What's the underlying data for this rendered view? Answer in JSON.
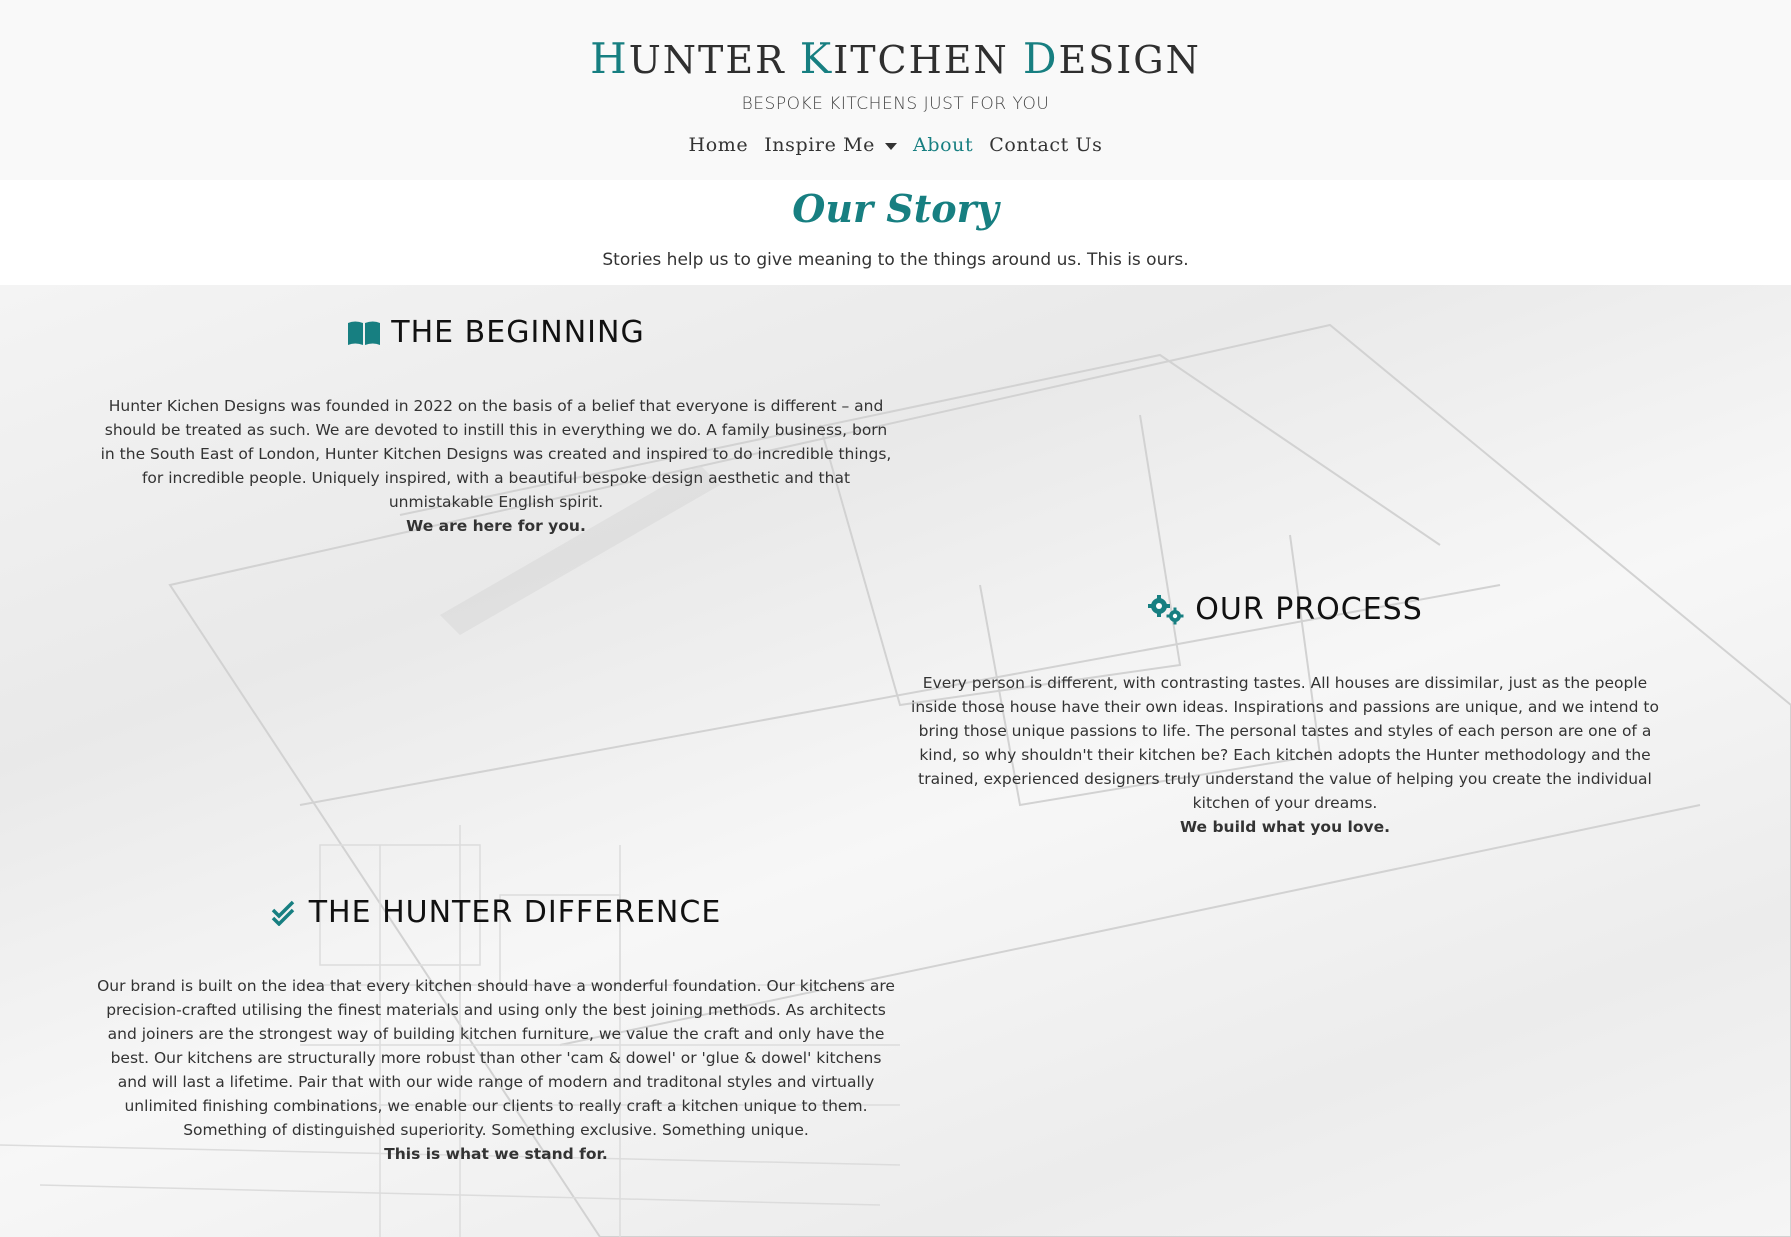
{
  "header": {
    "brand": {
      "w1_cap": "H",
      "w1_rest": "UNTER ",
      "w2_cap": "K",
      "w2_rest": "ITCHEN ",
      "w3_cap": "D",
      "w3_rest": "ESIGN"
    },
    "tagline": "BESPOKE KITCHENS JUST FOR YOU",
    "nav": {
      "home": "Home",
      "inspire": "Inspire Me",
      "about": "About",
      "contact": "Contact Us"
    },
    "accent_color": "#177f81"
  },
  "story": {
    "title": "Our Story",
    "subtitle": "Stories help us to give meaning to the things around us. This is ours."
  },
  "sections": {
    "beginning": {
      "icon": "book-open-icon",
      "title": "THE BEGINNING",
      "body": "Hunter Kichen Designs was founded in 2022 on the basis of a belief that everyone is different – and should be treated as such. We are devoted to instill this in everything we do. A family business, born in the South East of London, Hunter Kitchen Designs was created and inspired to do incredible things, for incredible people. Uniquely inspired, with a beautiful bespoke design aesthetic and that unmistakable English spirit.",
      "closing": "We are here for you."
    },
    "process": {
      "icon": "gears-icon",
      "title": "OUR PROCESS",
      "body": "Every person is different, with contrasting tastes. All houses are dissimilar, just as the people inside those house have their own ideas. Inspirations and passions are unique, and we intend to bring those unique passions to life. The personal tastes and styles of each person are one of a kind, so why shouldn't their kitchen be? Each kitchen adopts the Hunter methodology and the trained, experienced designers truly understand the value of helping you create the individual kitchen of your dreams.",
      "closing": "We build what you love."
    },
    "difference": {
      "icon": "double-check-icon",
      "title": "THE HUNTER DIFFERENCE",
      "body": "Our brand is built on the idea that every kitchen should have a wonderful foundation. Our kitchens are precision-crafted utilising the finest materials and using only the best joining methods. As architects and joiners are the strongest way of building kitchen furniture, we value the craft and only have the best. Our kitchens are structurally more robust than other 'cam & dowel' or 'glue & dowel' kitchens and will last a lifetime. Pair that with our wide range of modern and traditonal styles and virtually unlimited finishing combinations, we enable our clients to really craft a kitchen unique to them. Something of distinguished superiority. Something exclusive. Something unique.",
      "closing": "This is what we stand for."
    }
  }
}
